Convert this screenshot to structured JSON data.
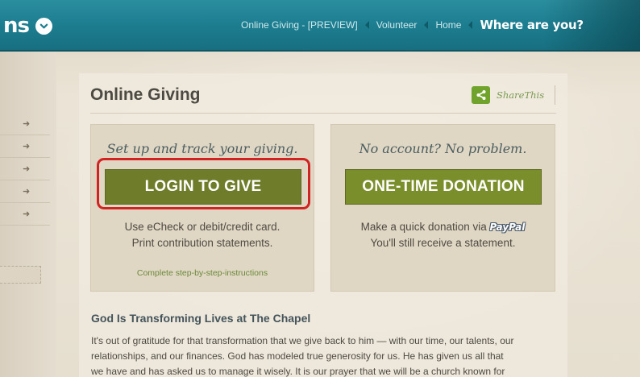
{
  "header": {
    "logo_fragment": "ns",
    "nav": [
      {
        "label": "Online Giving - [PREVIEW]"
      },
      {
        "label": "Volunteer"
      },
      {
        "label": "Home"
      }
    ],
    "where_label": "Where are you?"
  },
  "sidebar": {
    "items": [
      {
        "icon": "arrow-right-icon"
      },
      {
        "icon": "arrow-right-icon"
      },
      {
        "icon": "arrow-right-icon"
      },
      {
        "icon": "arrow-right-icon"
      },
      {
        "icon": "arrow-right-icon"
      }
    ]
  },
  "page": {
    "title": "Online Giving",
    "share_label": "ShareThis"
  },
  "login_card": {
    "heading": "Set up and track your giving.",
    "button_label": "LOGIN TO GIVE",
    "desc_line1": "Use eCheck or debit/credit card.",
    "desc_line2": "Print contribution statements.",
    "link_label": "Complete step-by-step-instructions"
  },
  "donation_card": {
    "heading": "No account? No problem.",
    "button_label": "ONE-TIME DONATION",
    "desc_line1_prefix": "Make a quick donation via",
    "paypal_label": "PayPal",
    "desc_line2": "You'll still receive a statement."
  },
  "section": {
    "title": "God Is Transforming Lives at The Chapel",
    "lines": [
      "It's out of gratitude for that transformation that we give back to him — with our time, our talents, our",
      "relationships, and our finances. God has modeled true generosity for us. He has given us all that",
      "we have and has asked us to manage it wisely. It is our prayer that we will be a church known for"
    ]
  },
  "colors": {
    "header_teal": "#1d7f91",
    "button_olive": "#6f7c2a",
    "highlight_red": "#d22323",
    "share_green": "#6fa32c"
  }
}
